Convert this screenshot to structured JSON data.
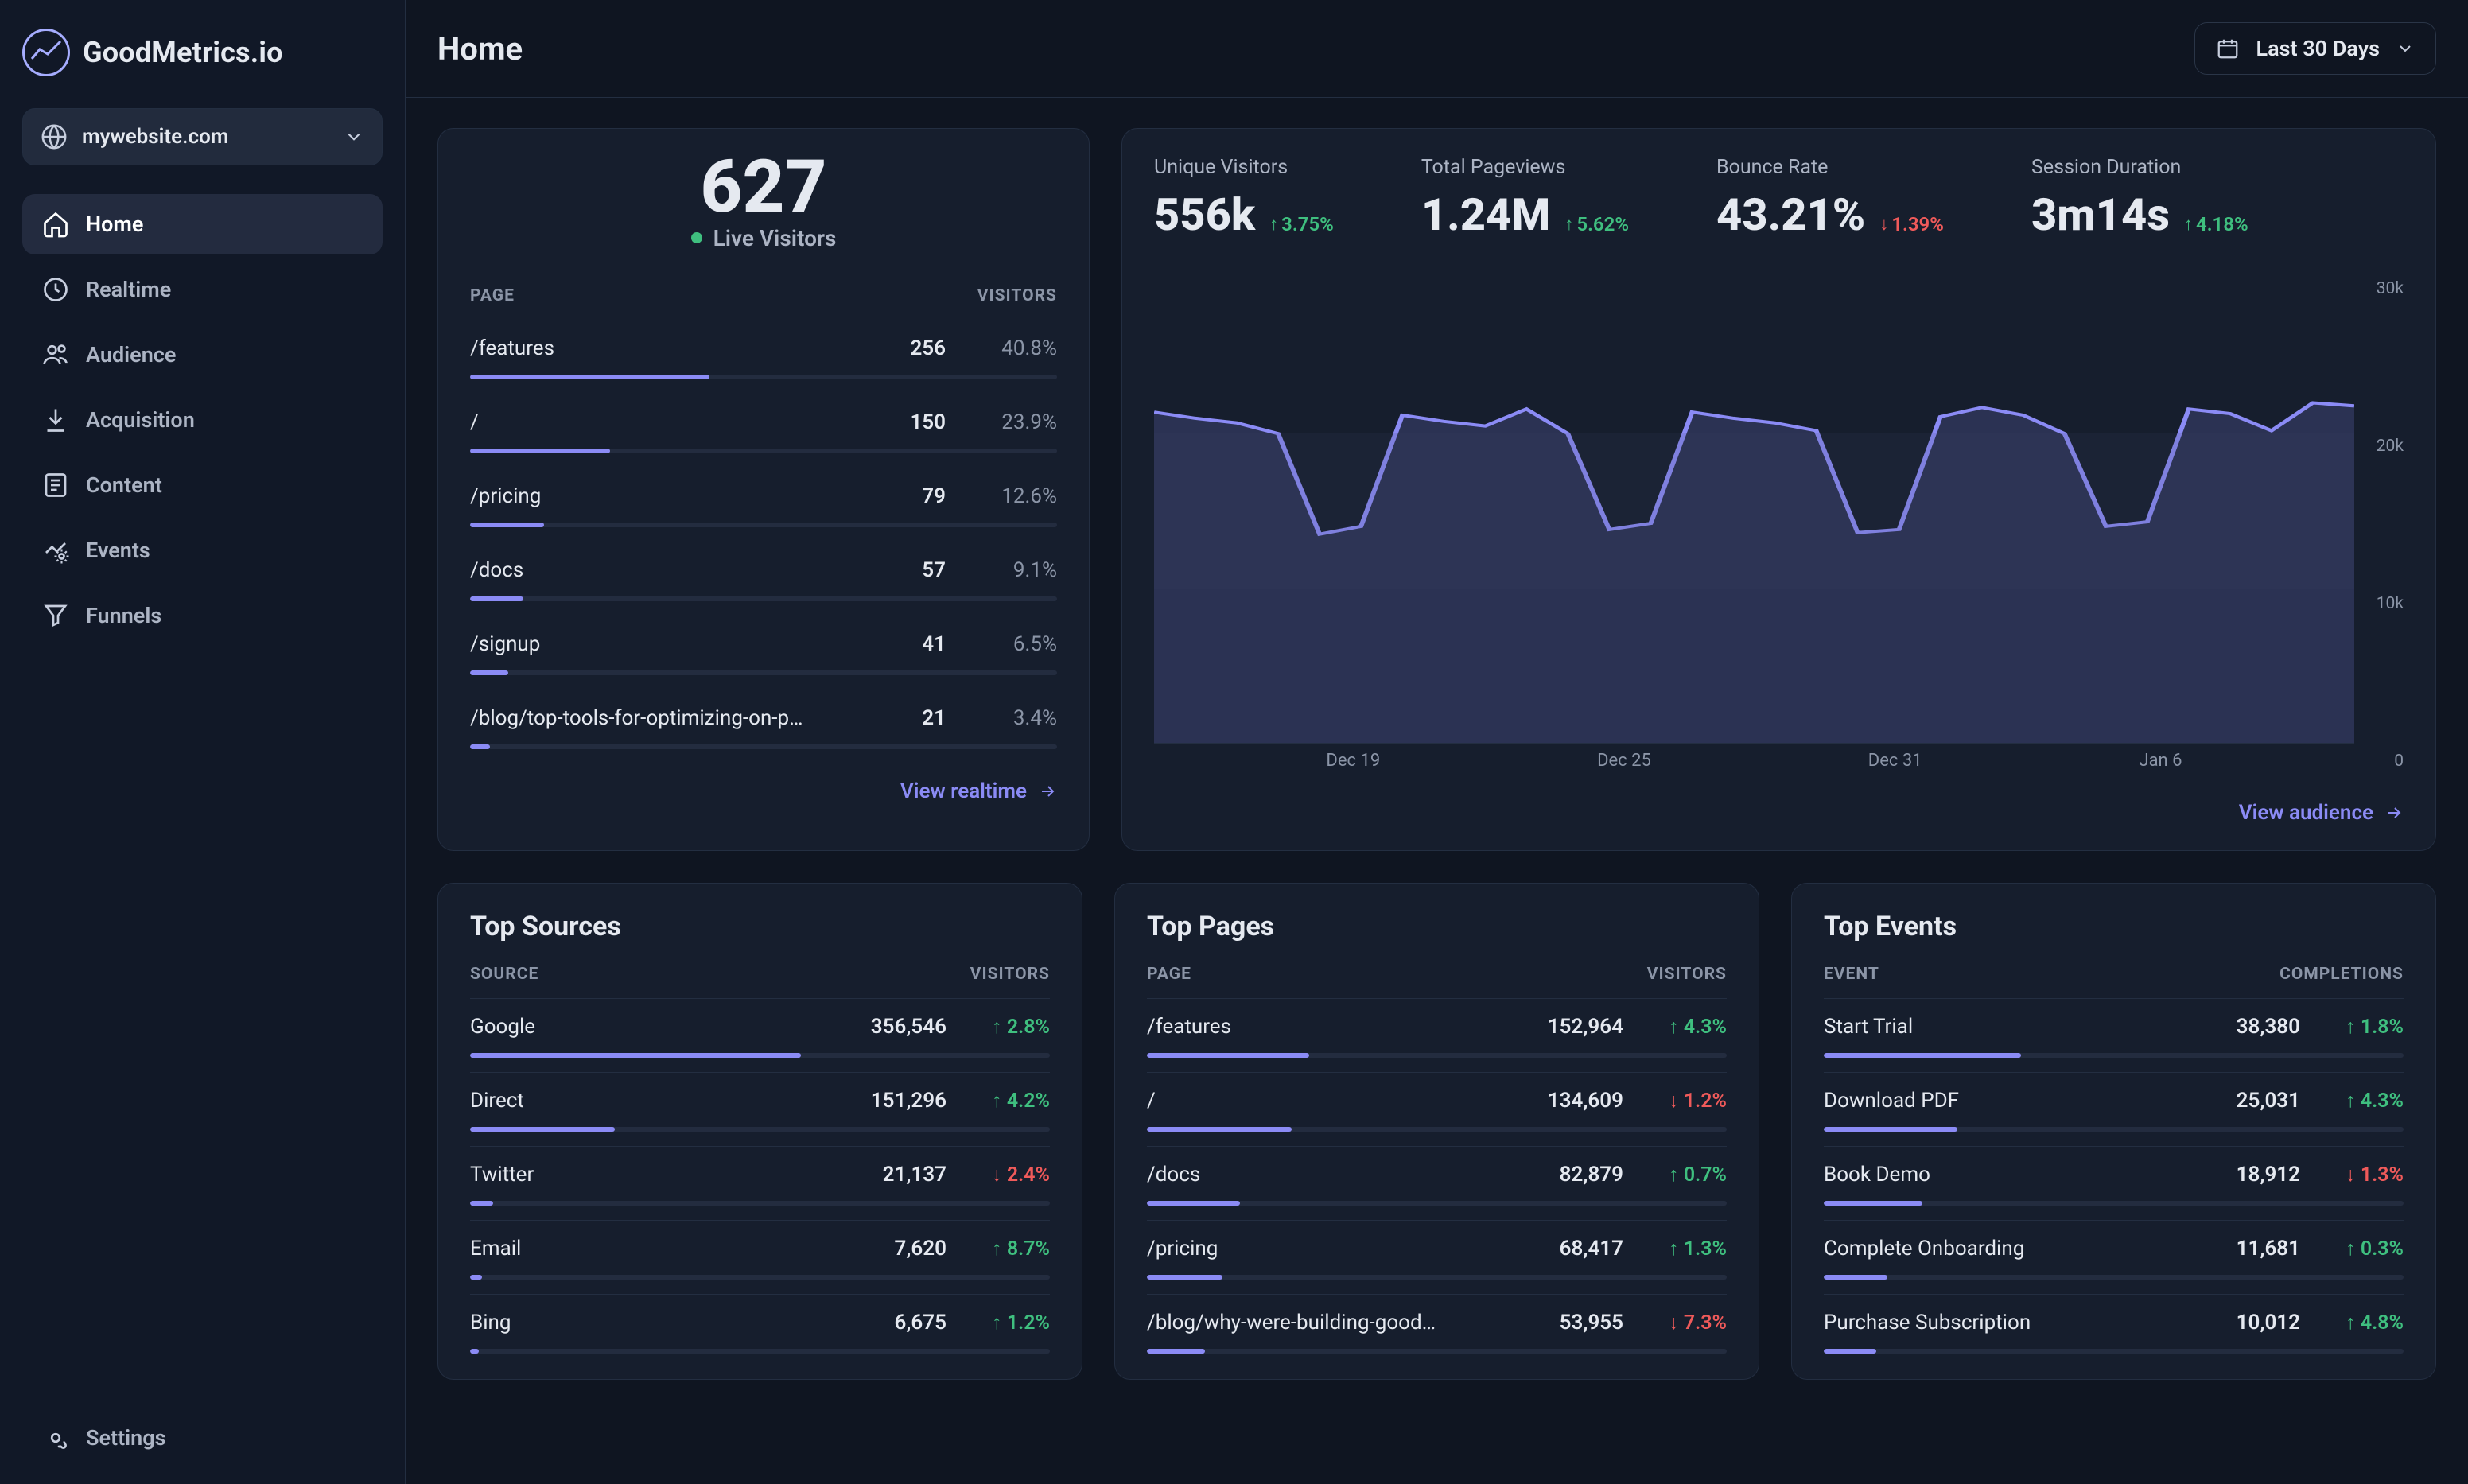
{
  "brand": "GoodMetrics.io",
  "site_selector": {
    "label": "mywebsite.com"
  },
  "nav": {
    "items": [
      {
        "key": "home",
        "label": "Home",
        "active": true
      },
      {
        "key": "realtime",
        "label": "Realtime"
      },
      {
        "key": "audience",
        "label": "Audience"
      },
      {
        "key": "acquisition",
        "label": "Acquisition"
      },
      {
        "key": "content",
        "label": "Content"
      },
      {
        "key": "events",
        "label": "Events"
      },
      {
        "key": "funnels",
        "label": "Funnels"
      }
    ],
    "settings_label": "Settings"
  },
  "page_title": "Home",
  "date_range": {
    "label": "Last 30 Days"
  },
  "live": {
    "count": "627",
    "label": "Live Visitors",
    "columns": {
      "a": "PAGE",
      "b": "VISITORS"
    },
    "rows": [
      {
        "path": "/features",
        "value": "256",
        "pct": "40.8%",
        "w": 40.8
      },
      {
        "path": "/",
        "value": "150",
        "pct": "23.9%",
        "w": 23.9
      },
      {
        "path": "/pricing",
        "value": "79",
        "pct": "12.6%",
        "w": 12.6
      },
      {
        "path": "/docs",
        "value": "57",
        "pct": "9.1%",
        "w": 9.1
      },
      {
        "path": "/signup",
        "value": "41",
        "pct": "6.5%",
        "w": 6.5
      },
      {
        "path": "/blog/top-tools-for-optimizing-on-p…",
        "value": "21",
        "pct": "3.4%",
        "w": 3.4
      }
    ],
    "view_link": "View realtime"
  },
  "stats": [
    {
      "label": "Unique Visitors",
      "value": "556k",
      "delta": "3.75%",
      "dir": "up"
    },
    {
      "label": "Total Pageviews",
      "value": "1.24M",
      "delta": "5.62%",
      "dir": "up"
    },
    {
      "label": "Bounce Rate",
      "value": "43.21%",
      "delta": "1.39%",
      "dir": "down"
    },
    {
      "label": "Session Duration",
      "value": "3m14s",
      "delta": "4.18%",
      "dir": "up"
    }
  ],
  "overview": {
    "view_link": "View audience",
    "y_ticks": [
      "30k",
      "20k",
      "10k",
      "0"
    ],
    "x_ticks": [
      "Dec 19",
      "Dec 25",
      "Dec 31",
      "Jan 6"
    ]
  },
  "chart_data": {
    "type": "area",
    "title": "",
    "xlabel": "",
    "ylabel": "",
    "ylim": [
      0,
      30000
    ],
    "x": [
      "Dec 14",
      "Dec 15",
      "Dec 16",
      "Dec 17",
      "Dec 18",
      "Dec 19",
      "Dec 20",
      "Dec 21",
      "Dec 22",
      "Dec 23",
      "Dec 24",
      "Dec 25",
      "Dec 26",
      "Dec 27",
      "Dec 28",
      "Dec 29",
      "Dec 30",
      "Dec 31",
      "Jan 1",
      "Jan 2",
      "Jan 3",
      "Jan 4",
      "Jan 5",
      "Jan 6",
      "Jan 7",
      "Jan 8",
      "Jan 9",
      "Jan 10",
      "Jan 11",
      "Jan 12"
    ],
    "series": [
      {
        "name": "Unique Visitors",
        "values": [
          21400,
          21000,
          20700,
          20000,
          13500,
          14000,
          21200,
          20800,
          20500,
          21600,
          20000,
          13800,
          14200,
          21400,
          21000,
          20700,
          20200,
          13600,
          13800,
          21100,
          21700,
          21200,
          20000,
          14000,
          14300,
          21600,
          21300,
          20200,
          22000,
          21800
        ]
      }
    ]
  },
  "top_sources": {
    "title": "Top Sources",
    "columns": {
      "a": "SOURCE",
      "b": "VISITORS"
    },
    "rows": [
      {
        "name": "Google",
        "value": "356,546",
        "delta": "2.8%",
        "dir": "up",
        "w": 57
      },
      {
        "name": "Direct",
        "value": "151,296",
        "delta": "4.2%",
        "dir": "up",
        "w": 25
      },
      {
        "name": "Twitter",
        "value": "21,137",
        "delta": "2.4%",
        "dir": "down",
        "w": 4
      },
      {
        "name": "Email",
        "value": "7,620",
        "delta": "8.7%",
        "dir": "up",
        "w": 2
      },
      {
        "name": "Bing",
        "value": "6,675",
        "delta": "1.2%",
        "dir": "up",
        "w": 1.5
      }
    ]
  },
  "top_pages": {
    "title": "Top Pages",
    "columns": {
      "a": "PAGE",
      "b": "VISITORS"
    },
    "rows": [
      {
        "name": "/features",
        "value": "152,964",
        "delta": "4.3%",
        "dir": "up",
        "w": 28
      },
      {
        "name": "/",
        "value": "134,609",
        "delta": "1.2%",
        "dir": "down",
        "w": 25
      },
      {
        "name": "/docs",
        "value": "82,879",
        "delta": "0.7%",
        "dir": "up",
        "w": 16
      },
      {
        "name": "/pricing",
        "value": "68,417",
        "delta": "1.3%",
        "dir": "up",
        "w": 13
      },
      {
        "name": "/blog/why-were-building-good…",
        "value": "53,955",
        "delta": "7.3%",
        "dir": "down",
        "w": 10
      }
    ]
  },
  "top_events": {
    "title": "Top Events",
    "columns": {
      "a": "EVENT",
      "b": "COMPLETIONS"
    },
    "rows": [
      {
        "name": "Start Trial",
        "value": "38,380",
        "delta": "1.8%",
        "dir": "up",
        "w": 34
      },
      {
        "name": "Download PDF",
        "value": "25,031",
        "delta": "4.3%",
        "dir": "up",
        "w": 23
      },
      {
        "name": "Book Demo",
        "value": "18,912",
        "delta": "1.3%",
        "dir": "down",
        "w": 17
      },
      {
        "name": "Complete Onboarding",
        "value": "11,681",
        "delta": "0.3%",
        "dir": "up",
        "w": 11
      },
      {
        "name": "Purchase Subscription",
        "value": "10,012",
        "delta": "4.8%",
        "dir": "up",
        "w": 9
      }
    ]
  }
}
